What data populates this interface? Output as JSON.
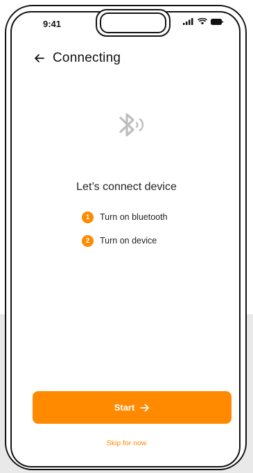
{
  "status_bar": {
    "time": "9:41"
  },
  "header": {
    "title": "Connecting"
  },
  "content": {
    "headline": "Let’s connect device",
    "steps": [
      {
        "number": "1",
        "text": "Turn on bluetooth"
      },
      {
        "number": "2",
        "text": "Turn on device"
      }
    ]
  },
  "actions": {
    "start_label": "Start",
    "skip_label": "Skip for now"
  },
  "icons": {
    "back": "arrow-left-icon",
    "bluetooth": "bluetooth-searching-icon",
    "signal": "cellular-signal-icon",
    "wifi": "wifi-icon",
    "battery": "battery-icon",
    "start_arrow": "arrow-right-icon"
  },
  "colors": {
    "accent": "#ff8a00",
    "text": "#222222",
    "illustration": "#bdbdbd",
    "backdrop": "#e9e9ea"
  }
}
